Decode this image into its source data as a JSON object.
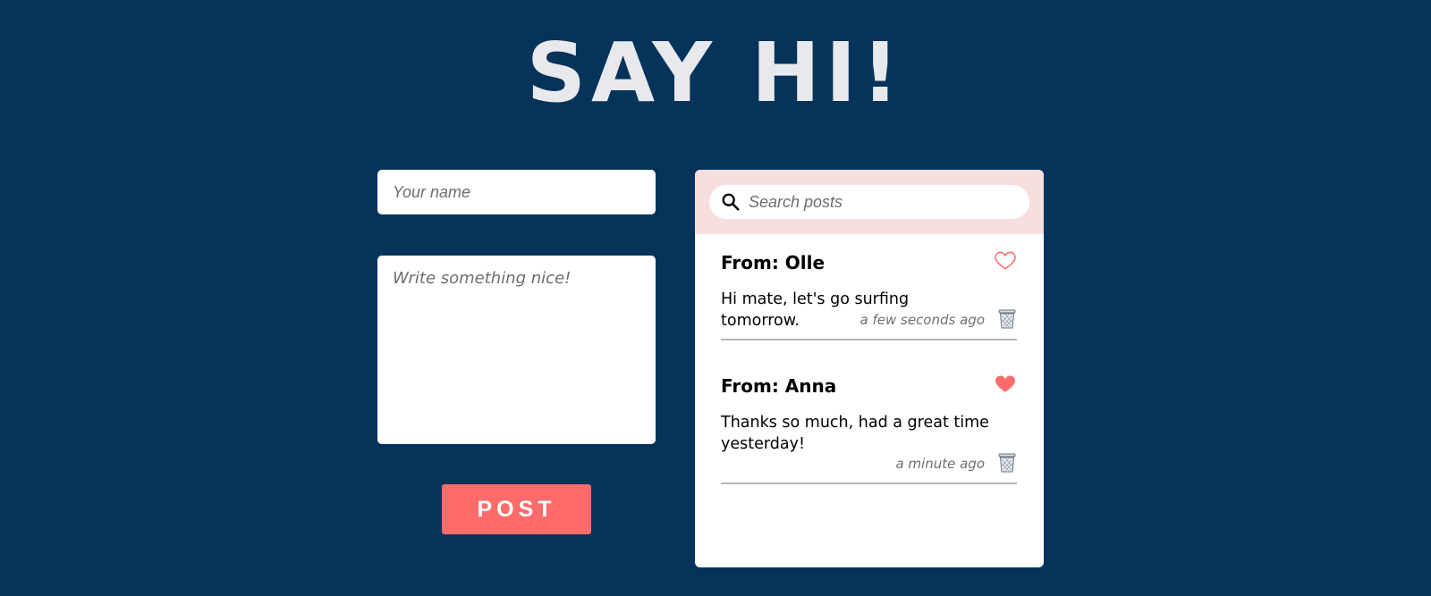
{
  "header": {
    "title": "SAY HI!"
  },
  "form": {
    "name_placeholder": "Your name",
    "message_placeholder": "Write something nice!",
    "post_label": "POST"
  },
  "feed": {
    "search_placeholder": "Search posts",
    "posts": [
      {
        "from": "From: Olle",
        "message": "Hi mate, let's go surfing tomorrow.",
        "time": "a few seconds ago",
        "liked": false
      },
      {
        "from": "From: Anna",
        "message": "Thanks so much, had a great time yesterday!",
        "time": "a minute ago",
        "liked": true
      }
    ]
  },
  "colors": {
    "background": "#06335a",
    "accent": "#fd6b6b",
    "search_header": "#f8dfdf"
  }
}
